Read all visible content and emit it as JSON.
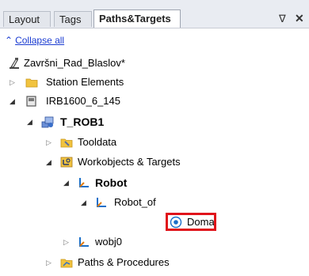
{
  "tabs": [
    {
      "label": "Layout"
    },
    {
      "label": "Tags"
    },
    {
      "label": "Paths&Targets"
    }
  ],
  "window_controls": {
    "pin": "⩟",
    "close": "✕"
  },
  "collapse_all": {
    "label": "Collapse all"
  },
  "tree": {
    "station": "Završni_Rad_Blaslov*",
    "station_elements": "Station Elements",
    "robot": "IRB1600_6_145",
    "task": "T_ROB1",
    "tooldata": "Tooldata",
    "workobjects": "Workobjects & Targets",
    "wobj_robot": "Robot",
    "robot_of": "Robot_of",
    "target": "Doma",
    "wobj0": "wobj0",
    "paths": "Paths & Procedures"
  },
  "colors": {
    "highlight": "#e0131a",
    "link": "#1a3bd1"
  }
}
